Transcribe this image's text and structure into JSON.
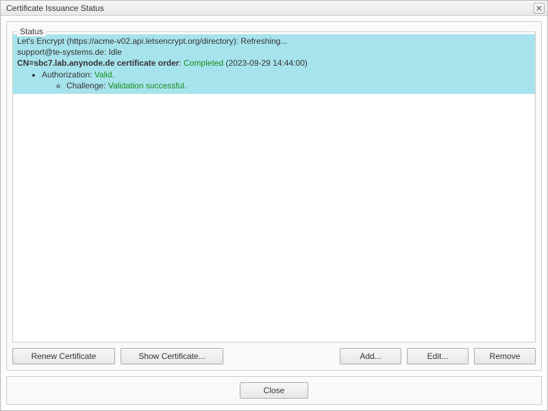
{
  "window": {
    "title": "Certificate Issuance Status"
  },
  "group": {
    "label": "Status"
  },
  "status": {
    "provider_prefix": "Let's Encrypt (https://acme-v02.api.letsencrypt.org/directory): ",
    "provider_state": "Refreshing...",
    "account_prefix": "support@te-systems.de: ",
    "account_state": "Idle",
    "order_prefix": "CN=sbc7.lab.anynode.de certificate order",
    "order_sep": ": ",
    "order_state": "Completed",
    "order_time": "(2023-09-29 14:44:00)",
    "auth_prefix": "Authorization: ",
    "auth_state": "Valid.",
    "challenge_prefix": "Challenge: ",
    "challenge_state": "Validation successful."
  },
  "buttons": {
    "renew": "Renew Certificate",
    "show": "Show Certificate...",
    "add": "Add...",
    "edit": "Edit...",
    "remove": "Remove",
    "close": "Close"
  }
}
